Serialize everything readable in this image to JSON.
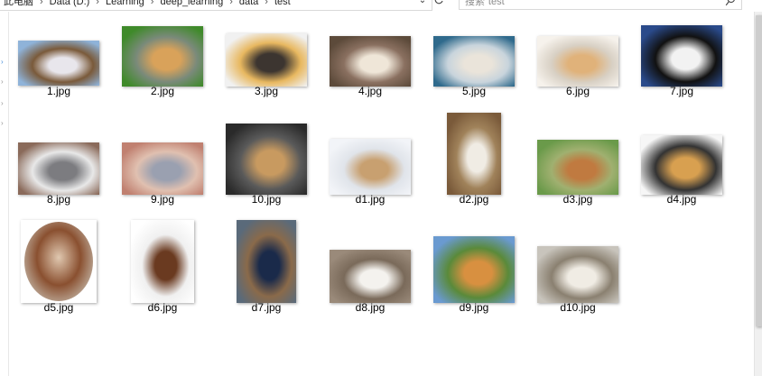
{
  "address": {
    "crumbs": [
      "此电脑",
      "Data (D:)",
      "Learning",
      "deep_learning",
      "data",
      "test"
    ]
  },
  "search": {
    "placeholder": "搜索\"test\""
  },
  "files": [
    {
      "name": "1.jpg",
      "colors": [
        "#8fb3d9",
        "#e8e6ec",
        "#7a5a3a"
      ]
    },
    {
      "name": "2.jpg",
      "colors": [
        "#3f8a2a",
        "#d9a25a",
        "#7a8a7a"
      ]
    },
    {
      "name": "3.jpg",
      "colors": [
        "#f1f1f1",
        "#3c3530",
        "#e8b860"
      ]
    },
    {
      "name": "4.jpg",
      "colors": [
        "#5c4a3a",
        "#efe6d8",
        "#8a7060"
      ]
    },
    {
      "name": "5.jpg",
      "colors": [
        "#2f6a8c",
        "#eae4da",
        "#c8d4dc"
      ]
    },
    {
      "name": "6.jpg",
      "colors": [
        "#f6f2ec",
        "#e0b27a",
        "#d8d0c4"
      ]
    },
    {
      "name": "7.jpg",
      "colors": [
        "#2a4a8a",
        "#f2f2f2",
        "#111111"
      ]
    },
    {
      "name": "8.jpg",
      "colors": [
        "#8a6a5a",
        "#7c7c80",
        "#e8e8e8"
      ]
    },
    {
      "name": "9.jpg",
      "colors": [
        "#c08070",
        "#9aa0b0",
        "#e0c0b0"
      ]
    },
    {
      "name": "10.jpg",
      "colors": [
        "#2a2a2a",
        "#c89a60",
        "#5a5a5a"
      ]
    },
    {
      "name": "d1.jpg",
      "colors": [
        "#f2f4f8",
        "#c8a070",
        "#e0e4ea"
      ]
    },
    {
      "name": "d2.jpg",
      "colors": [
        "#7a5a3a",
        "#f0ece4",
        "#a0825a"
      ]
    },
    {
      "name": "d3.jpg",
      "colors": [
        "#6a9a4a",
        "#c07a40",
        "#a0b070"
      ]
    },
    {
      "name": "d4.jpg",
      "colors": [
        "#f6f6f6",
        "#d8a050",
        "#333333"
      ]
    },
    {
      "name": "d5.jpg",
      "colors": [
        "#ffffff",
        "#8a5030",
        "#e0c8b0"
      ]
    },
    {
      "name": "d6.jpg",
      "colors": [
        "#ffffff",
        "#6a3a20",
        "#f0f0f0"
      ]
    },
    {
      "name": "d7.jpg",
      "colors": [
        "#5a6a7a",
        "#1a2a4a",
        "#8a6a4a"
      ]
    },
    {
      "name": "d8.jpg",
      "colors": [
        "#9a8a7a",
        "#f4f2ee",
        "#7a6a5a"
      ]
    },
    {
      "name": "d9.jpg",
      "colors": [
        "#6a9ad0",
        "#d89040",
        "#5a8a3a"
      ]
    },
    {
      "name": "d10.jpg",
      "colors": [
        "#c8c4bc",
        "#f0ece4",
        "#8a8070"
      ]
    }
  ]
}
